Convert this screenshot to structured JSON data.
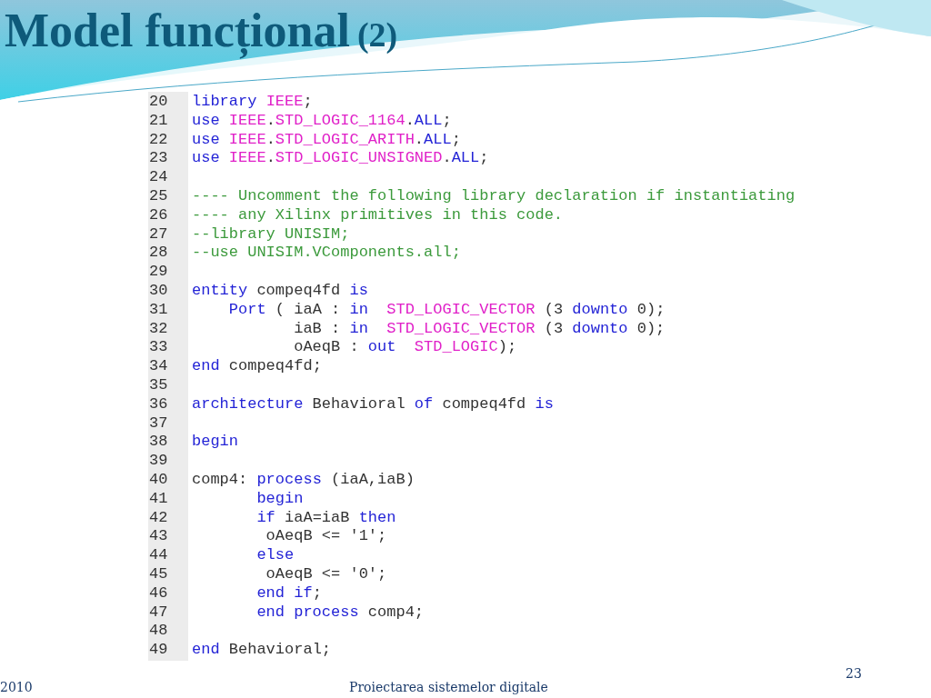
{
  "title": {
    "text": "Model funcțional",
    "suffix": "(2)"
  },
  "code": {
    "lines": [
      {
        "number": "20",
        "tokens": [
          {
            "kind": "k",
            "text": "library "
          },
          {
            "kind": "t",
            "text": "IEEE"
          },
          {
            "kind": "p",
            "text": ";"
          }
        ]
      },
      {
        "number": "21",
        "tokens": [
          {
            "kind": "k",
            "text": "use "
          },
          {
            "kind": "t",
            "text": "IEEE"
          },
          {
            "kind": "p",
            "text": "."
          },
          {
            "kind": "t",
            "text": "STD_LOGIC_1164"
          },
          {
            "kind": "p",
            "text": "."
          },
          {
            "kind": "k",
            "text": "ALL"
          },
          {
            "kind": "p",
            "text": ";"
          }
        ]
      },
      {
        "number": "22",
        "tokens": [
          {
            "kind": "k",
            "text": "use "
          },
          {
            "kind": "t",
            "text": "IEEE"
          },
          {
            "kind": "p",
            "text": "."
          },
          {
            "kind": "t",
            "text": "STD_LOGIC_ARITH"
          },
          {
            "kind": "p",
            "text": "."
          },
          {
            "kind": "k",
            "text": "ALL"
          },
          {
            "kind": "p",
            "text": ";"
          }
        ]
      },
      {
        "number": "23",
        "tokens": [
          {
            "kind": "k",
            "text": "use "
          },
          {
            "kind": "t",
            "text": "IEEE"
          },
          {
            "kind": "p",
            "text": "."
          },
          {
            "kind": "t",
            "text": "STD_LOGIC_UNSIGNED"
          },
          {
            "kind": "p",
            "text": "."
          },
          {
            "kind": "k",
            "text": "ALL"
          },
          {
            "kind": "p",
            "text": ";"
          }
        ]
      },
      {
        "number": "24"
      },
      {
        "number": "25",
        "tokens": [
          {
            "kind": "c",
            "text": "---- Uncomment the following library declaration if instantiating"
          }
        ]
      },
      {
        "number": "26",
        "tokens": [
          {
            "kind": "c",
            "text": "---- any Xilinx primitives in this code."
          }
        ]
      },
      {
        "number": "27",
        "tokens": [
          {
            "kind": "c",
            "text": "--library UNISIM;"
          }
        ]
      },
      {
        "number": "28",
        "tokens": [
          {
            "kind": "c",
            "text": "--use UNISIM.VComponents.all;"
          }
        ]
      },
      {
        "number": "29"
      },
      {
        "number": "30",
        "tokens": [
          {
            "kind": "k",
            "text": "entity"
          },
          {
            "kind": "p",
            "text": " compeq4fd "
          },
          {
            "kind": "k",
            "text": "is"
          }
        ]
      },
      {
        "number": "31",
        "tokens": [
          {
            "kind": "k",
            "text": "    Port"
          },
          {
            "kind": "p",
            "text": " ( iaA : "
          },
          {
            "kind": "k",
            "text": "in  "
          },
          {
            "kind": "t",
            "text": "STD_LOGIC_VECTOR"
          },
          {
            "kind": "p",
            "text": " (3 "
          },
          {
            "kind": "k",
            "text": "downto"
          },
          {
            "kind": "p",
            "text": " 0);"
          }
        ]
      },
      {
        "number": "32",
        "tokens": [
          {
            "kind": "p",
            "text": "           iaB : "
          },
          {
            "kind": "k",
            "text": "in  "
          },
          {
            "kind": "t",
            "text": "STD_LOGIC_VECTOR"
          },
          {
            "kind": "p",
            "text": " (3 "
          },
          {
            "kind": "k",
            "text": "downto"
          },
          {
            "kind": "p",
            "text": " 0);"
          }
        ]
      },
      {
        "number": "33",
        "tokens": [
          {
            "kind": "p",
            "text": "           oAeqB : "
          },
          {
            "kind": "k",
            "text": "out  "
          },
          {
            "kind": "t",
            "text": "STD_LOGIC"
          },
          {
            "kind": "p",
            "text": ");"
          }
        ]
      },
      {
        "number": "34",
        "tokens": [
          {
            "kind": "k",
            "text": "end"
          },
          {
            "kind": "p",
            "text": " compeq4fd;"
          }
        ]
      },
      {
        "number": "35"
      },
      {
        "number": "36",
        "tokens": [
          {
            "kind": "k",
            "text": "architecture"
          },
          {
            "kind": "p",
            "text": " Behavioral "
          },
          {
            "kind": "k",
            "text": "of"
          },
          {
            "kind": "p",
            "text": " compeq4fd "
          },
          {
            "kind": "k",
            "text": "is"
          }
        ]
      },
      {
        "number": "37"
      },
      {
        "number": "38",
        "tokens": [
          {
            "kind": "k",
            "text": "begin"
          }
        ]
      },
      {
        "number": "39"
      },
      {
        "number": "40",
        "tokens": [
          {
            "kind": "p",
            "text": "comp4: "
          },
          {
            "kind": "k",
            "text": "process"
          },
          {
            "kind": "p",
            "text": " (iaA,iaB)"
          }
        ]
      },
      {
        "number": "41",
        "tokens": [
          {
            "kind": "k",
            "text": "       begin"
          }
        ]
      },
      {
        "number": "42",
        "tokens": [
          {
            "kind": "k",
            "text": "       if"
          },
          {
            "kind": "p",
            "text": " iaA=iaB "
          },
          {
            "kind": "k",
            "text": "then"
          }
        ]
      },
      {
        "number": "43",
        "tokens": [
          {
            "kind": "p",
            "text": "        oAeqB <= '1';"
          }
        ]
      },
      {
        "number": "44",
        "tokens": [
          {
            "kind": "k",
            "text": "       else"
          }
        ]
      },
      {
        "number": "45",
        "tokens": [
          {
            "kind": "p",
            "text": "        oAeqB <= '0';"
          }
        ]
      },
      {
        "number": "46",
        "tokens": [
          {
            "kind": "k",
            "text": "       end if"
          },
          {
            "kind": "p",
            "text": ";"
          }
        ]
      },
      {
        "number": "47",
        "tokens": [
          {
            "kind": "k",
            "text": "       end process"
          },
          {
            "kind": "p",
            "text": " comp4;"
          }
        ]
      },
      {
        "number": "48"
      },
      {
        "number": "49",
        "tokens": [
          {
            "kind": "k",
            "text": "end"
          },
          {
            "kind": "p",
            "text": " Behavioral;"
          }
        ]
      }
    ]
  },
  "footer": {
    "date": "2010",
    "course": "Proiectarea sistemelor digitale",
    "page_number": "23"
  }
}
